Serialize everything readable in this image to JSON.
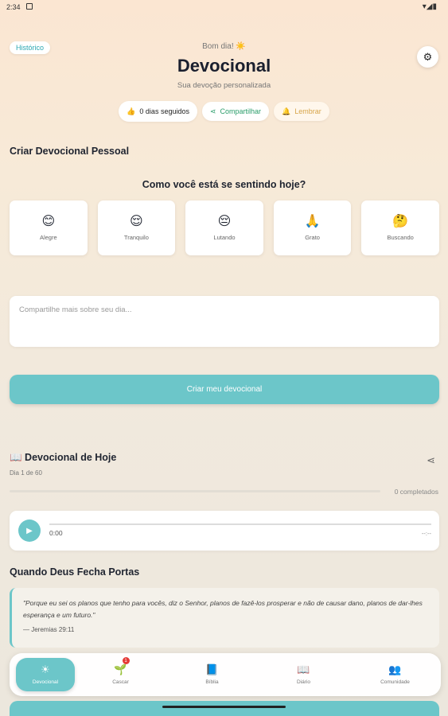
{
  "status_bar": {
    "time": "2:34",
    "right_icons": "▾◢▮"
  },
  "header": {
    "history_label": "Histórico",
    "greeting": "Bom dia! ☀️",
    "title": "Devocional",
    "subtitle": "Sua devoção personalizada"
  },
  "pills": {
    "streak_icon": "👍",
    "streak_label": "0 dias seguidos",
    "share_icon": "⋖",
    "share_label": "Compartilhar",
    "remind_icon": "🔔",
    "remind_label": "Lembrar"
  },
  "create_section": {
    "title": "Criar Devocional Pessoal",
    "question": "Como você está se sentindo hoje?",
    "moods": [
      {
        "emoji": "😊",
        "label": "Alegre"
      },
      {
        "emoji": "😌",
        "label": "Tranquilo"
      },
      {
        "emoji": "😔",
        "label": "Lutando"
      },
      {
        "emoji": "🙏",
        "label": "Grato"
      },
      {
        "emoji": "🤔",
        "label": "Buscando"
      }
    ],
    "input_placeholder": "Compartilhe mais sobre seu dia...",
    "create_button": "Criar meu devocional"
  },
  "today": {
    "title": "📖 Devocional de Hoje",
    "day_counter": "Dia 1 de 60",
    "progress": 0,
    "completed_label": "0 completados",
    "audio": {
      "current_time": "0:00",
      "duration": "--:--"
    }
  },
  "devotional": {
    "title": "Quando Deus Fecha Portas",
    "verse": "\"Porque eu sei os planos que tenho para vocês, diz o Senhor, planos de fazê-los prosperar e não de causar dano, planos de dar-lhes esperança e um futuro.\"",
    "reference": "— Jeremias 29:11"
  },
  "bottom_nav": {
    "items": [
      {
        "icon": "☀",
        "label": "Devocional"
      },
      {
        "icon": "🌱",
        "label": "Cascar",
        "badge": "1"
      },
      {
        "icon": "📘",
        "label": "Bíblia"
      },
      {
        "icon": "📖",
        "label": "Diário"
      },
      {
        "icon": "👥",
        "label": "Comunidade"
      }
    ]
  },
  "colors": {
    "accent": "#6cc6c9",
    "share_green": "#2a9d6a",
    "badge_red": "#e53935"
  }
}
